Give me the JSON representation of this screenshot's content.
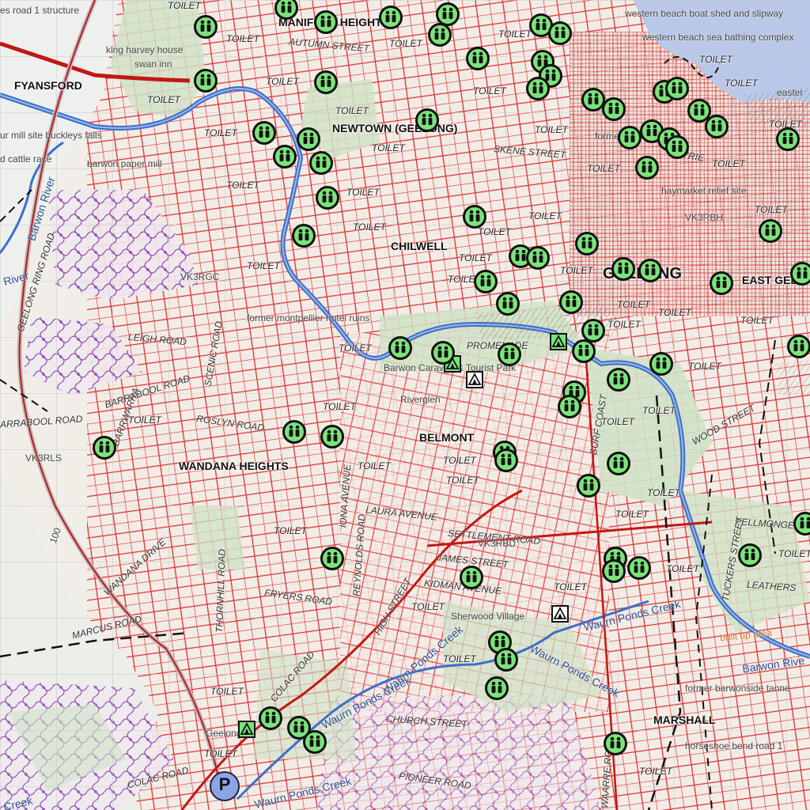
{
  "colors": {
    "marker_fill": "#7be37a",
    "marker_border": "#111111",
    "road": "#d21f1f",
    "track": "#8a3bb0",
    "river": "#3b6fc9",
    "park": "#cfe3c6",
    "water_body": "#b9c8e8",
    "parking": "#8aa4e8"
  },
  "icons": {
    "toilet_marker": "toilet-icon",
    "campground": "tent-icon",
    "parking": "parking-icon"
  },
  "labels": {
    "places": [
      {
        "name": "place-fyansford",
        "text": "FYANSFORD"
      },
      {
        "name": "place-manifold-heights",
        "text": "MANIFOLD HEIGHTS"
      },
      {
        "name": "place-newtown",
        "text": "NEWTOWN (GEELONG)"
      },
      {
        "name": "place-chilwell",
        "text": "CHILWELL"
      },
      {
        "name": "place-belmont",
        "text": "BELMONT"
      },
      {
        "name": "place-wandana-heights",
        "text": "WANDANA HEIGHTS"
      },
      {
        "name": "place-marshall",
        "text": "MARSHALL"
      },
      {
        "name": "place-east-geelong",
        "text": "EAST GEEL"
      }
    ],
    "city": {
      "text": "GEELONG"
    },
    "roads": [
      {
        "name": "road-autumn-street",
        "text": "AUTUMN STREET"
      },
      {
        "name": "road-skene-street",
        "text": "SKENE STREET"
      },
      {
        "name": "road-leigh-road",
        "text": "LEIGH ROAD"
      },
      {
        "name": "road-barrabool-road",
        "text": "BARRABOOL ROAD"
      },
      {
        "name": "road-barrabool-road-2",
        "text": "ARRABOOL ROAD"
      },
      {
        "name": "road-roslyn-road",
        "text": "ROSLYN ROAD"
      },
      {
        "name": "road-scenic-road",
        "text": "SCENIC ROAD"
      },
      {
        "name": "road-geelong-ring-road",
        "text": "GEELONG RING ROAD"
      },
      {
        "name": "road-laura-avenue",
        "text": "LAURA AVENUE"
      },
      {
        "name": "road-settlement-road",
        "text": "SETTLEMENT ROAD"
      },
      {
        "name": "road-james-street",
        "text": "JAMES STREET"
      },
      {
        "name": "road-kidman-avenue",
        "text": "KIDMAN AVENUE"
      },
      {
        "name": "road-fryers-road",
        "text": "FRYERS ROAD"
      },
      {
        "name": "road-marcus-road",
        "text": "MARCUS ROAD"
      },
      {
        "name": "road-wandana-drive",
        "text": "WANDANA DRIVE"
      },
      {
        "name": "road-thornhill-road",
        "text": "THORNHILL ROAD"
      },
      {
        "name": "road-reynolds-road",
        "text": "REYNOLDS ROAD"
      },
      {
        "name": "road-iona-avenue",
        "text": "IONA AVENUE"
      },
      {
        "name": "road-high-street",
        "text": "HIGH STREET"
      },
      {
        "name": "road-colac-road",
        "text": "COLAC ROAD"
      },
      {
        "name": "road-colac-road-2",
        "text": "COLAC ROAD"
      },
      {
        "name": "road-church-street",
        "text": "CHURCH STREET"
      },
      {
        "name": "road-pioneer-road",
        "text": "PIONEER ROAD"
      },
      {
        "name": "road-wood-street",
        "text": "WOOD STREET"
      },
      {
        "name": "road-fellmongers",
        "text": "FELLMONGER"
      },
      {
        "name": "road-leather-street",
        "text": "LEATHERS"
      },
      {
        "name": "road-tuckers-street",
        "text": "TUCKERS STREET"
      },
      {
        "name": "road-barwon-heads",
        "text": "WAARRE ROAD"
      },
      {
        "name": "road-promenade",
        "text": "PROMENADE"
      },
      {
        "name": "road-surf-coast",
        "text": "SURF COAST"
      },
      {
        "name": "road-buckley",
        "text": "BARRWARRA"
      },
      {
        "name": "road-ryrie",
        "text": "RYRIE"
      }
    ],
    "features": [
      {
        "name": "feature-king-harvey-house",
        "text": "king harvey house"
      },
      {
        "name": "feature-swan-inn",
        "text": "swan inn"
      },
      {
        "name": "feature-mill-site",
        "text": "ur mill site buckleys falls"
      },
      {
        "name": "feature-cattle-race",
        "text": "d cattle race"
      },
      {
        "name": "feature-barwon-paper-mill",
        "text": "barwon paper mill"
      },
      {
        "name": "feature-road-1-structure",
        "text": "es road 1 structure"
      },
      {
        "name": "feature-western-beach-boat-shed",
        "text": "western beach boat shed and slipway"
      },
      {
        "name": "feature-western-beach-sea-bathing",
        "text": "western beach sea bathing complex"
      },
      {
        "name": "feature-former-montpellier",
        "text": "former montpellier hotel ruins"
      },
      {
        "name": "feature-barwon-caravan-park",
        "text": "Barwon Caravan & Tourist Park"
      },
      {
        "name": "feature-riverglen",
        "text": "Riverglen"
      },
      {
        "name": "feature-sherwood-village",
        "text": "Sherwood Village"
      },
      {
        "name": "feature-haymarket",
        "text": "haymarket relief site"
      },
      {
        "name": "feature-vk3rbd",
        "text": "VK3RBD"
      },
      {
        "name": "feature-vk3rgc",
        "text": "VK3RGC"
      },
      {
        "name": "feature-vk3rbh",
        "text": "VK3RBH"
      },
      {
        "name": "feature-vk3rls",
        "text": "VK3RLS"
      },
      {
        "name": "feature-built-up-area",
        "text": "built up area"
      },
      {
        "name": "feature-former-barwonside",
        "text": "former barwonside tanne"
      },
      {
        "name": "feature-horseshoe-bend",
        "text": "horseshoe bend road 1"
      },
      {
        "name": "feature-geelong",
        "text": "Geelong"
      },
      {
        "name": "feature-elevation-100",
        "text": "100"
      },
      {
        "name": "feature-former-corner",
        "text": "former"
      },
      {
        "name": "feature-easter",
        "text": "easter"
      }
    ],
    "water": [
      {
        "name": "water-barwon-river",
        "text": "Barwon River"
      },
      {
        "name": "water-barwon-river-east",
        "text": "Barwon Rive"
      },
      {
        "name": "water-river-west",
        "text": "River"
      },
      {
        "name": "water-waurn-ponds-creek-1",
        "text": "Waurn Ponds Creek"
      },
      {
        "name": "water-waurn-ponds-creek-2",
        "text": "Waurn Ponds Creek"
      },
      {
        "name": "water-waurn-ponds-creek-3",
        "text": "Waurn Ponds Creek"
      },
      {
        "name": "water-waurn-ponds-creek-4",
        "text": "Waurn Ponds Creek"
      },
      {
        "name": "water-waurn-ponds-creek-5",
        "text": "Waurn Ponds Creek"
      },
      {
        "name": "water-creek-sw",
        "text": "Creek"
      }
    ],
    "toilet_text": "TOILET",
    "parking_letter": "P"
  },
  "toilet_markers_count": 72
}
